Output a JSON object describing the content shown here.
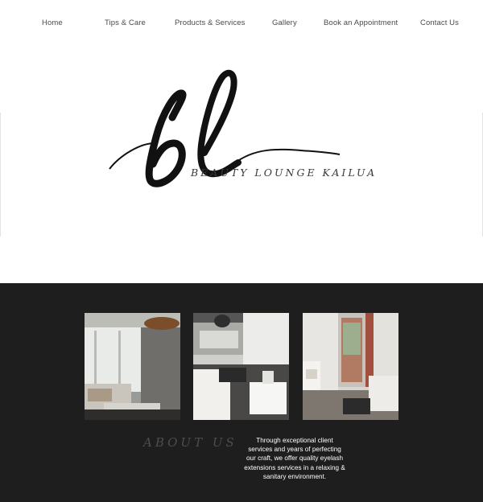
{
  "nav": {
    "items": [
      {
        "label": "Home"
      },
      {
        "label": "Tips  &  Care"
      },
      {
        "label": "Products  &  Services"
      },
      {
        "label": "Gallery"
      },
      {
        "label": "Book an Appointment"
      },
      {
        "label": "Contact Us"
      }
    ]
  },
  "logo": {
    "monogram": "bl",
    "tagline": "BEAUTY LOUNGE KAILUA"
  },
  "about": {
    "title": "ABOUT US",
    "text": "Through exceptional client services and years of perfecting our craft, we offer quality eyelash extensions services in a relaxing & sanitary environment.",
    "photos": [
      {
        "subject": "lounge-window-seating"
      },
      {
        "subject": "lounge-sofa-and-mirror"
      },
      {
        "subject": "hallway-to-entrance"
      }
    ]
  },
  "colors": {
    "section_dark": "#1e1e1e",
    "nav_text": "#4a4a4a",
    "logo_ink": "#111111"
  }
}
